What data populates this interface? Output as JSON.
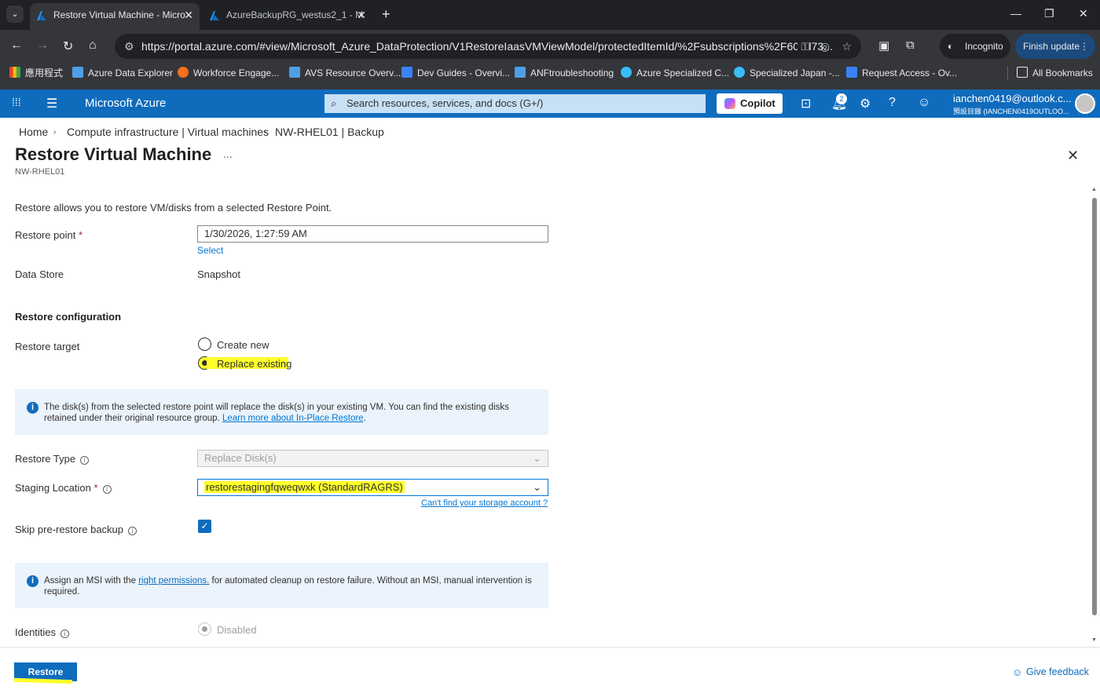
{
  "browser": {
    "tabs": [
      {
        "title": "Restore Virtual Machine - Micro",
        "active": true
      },
      {
        "title": "AzureBackupRG_westus2_1 - M",
        "active": false
      }
    ],
    "new_tab": "+",
    "window_controls": {
      "minimize": "—",
      "maximize": "❐",
      "close": "✕"
    },
    "url": "https://portal.azure.com/#view/Microsoft_Azure_DataProtection/V1RestoreIaasVMViewModel/protectedItemId/%2Fsubscriptions%2F600d73...",
    "incognito_label": "Incognito",
    "finish_update_label": "Finish update",
    "bookmarks": [
      {
        "label": "應用程式",
        "color": "#fbbc04"
      },
      {
        "label": "Azure Data Explorer",
        "color": "#4f9fe6"
      },
      {
        "label": "Workforce Engage...",
        "color": "#f2711c"
      },
      {
        "label": "AVS Resource Overv...",
        "color": "#4f9fe6"
      },
      {
        "label": "Dev Guides - Overvi...",
        "color": "#3b82f6"
      },
      {
        "label": "ANFtroubleshooting",
        "color": "#4f9fe6"
      },
      {
        "label": "Azure Specialized C...",
        "color": "#38bdf8"
      },
      {
        "label": "Specialized Japan -...",
        "color": "#38bdf8"
      },
      {
        "label": "Request Access - Ov...",
        "color": "#3b82f6"
      }
    ],
    "all_bookmarks": "All Bookmarks"
  },
  "azure_header": {
    "brand": "Microsoft Azure",
    "search_placeholder": "Search resources, services, and docs (G+/)",
    "copilot_label": "Copilot",
    "notifications_count": "2",
    "account_name": "ianchen0419@outlook.c...",
    "account_directory": "預設目錄 (IANCHEN0419OUTLOO..."
  },
  "breadcrumb": [
    "Home",
    "Compute infrastructure | Virtual machines",
    "NW-RHEL01 | Backup"
  ],
  "page": {
    "title": "Restore Virtual Machine",
    "more": "...",
    "subtitle": "NW-RHEL01",
    "intro": "Restore allows you to restore VM/disks from a selected Restore Point."
  },
  "form": {
    "restore_point_label": "Restore point",
    "restore_point_value": "1/30/2026, 1:27:59 AM",
    "select_link": "Select",
    "data_store_label": "Data Store",
    "data_store_value": "Snapshot",
    "restore_config_heading": "Restore configuration",
    "restore_target_label": "Restore target",
    "option_create_new": "Create new",
    "option_replace_existing": "Replace existing",
    "selected_option": "Replace existing",
    "info1_text": "The disk(s) from the selected restore point will replace the disk(s) in your existing VM. You can find the existing disks retained under their original resource group.",
    "info1_link": "Learn more about In-Place Restore",
    "info1_end": ".",
    "restore_type_label": "Restore Type",
    "restore_type_value": "Replace Disk(s)",
    "staging_label": "Staging Location",
    "staging_value": "restorestagingfqweqwxk (StandardRAGRS)",
    "storage_link": "Can't find your storage account ?",
    "skip_label": "Skip pre-restore backup",
    "skip_checked": true,
    "info2_pre": "Assign an MSI with the",
    "info2_link": "right permissions.",
    "info2_post": "for automated cleanup on restore failure. Without an MSI, manual intervention is required.",
    "identities_label": "Identities",
    "identities_value": "Disabled"
  },
  "footer": {
    "restore_button": "Restore",
    "feedback_link": "Give feedback"
  },
  "colors": {
    "azure_blue": "#0f6cbd",
    "link": "#0078d4",
    "highlight": "#ffff2a",
    "info_bg": "#ebf3fc",
    "chrome_dark": "#202124"
  }
}
